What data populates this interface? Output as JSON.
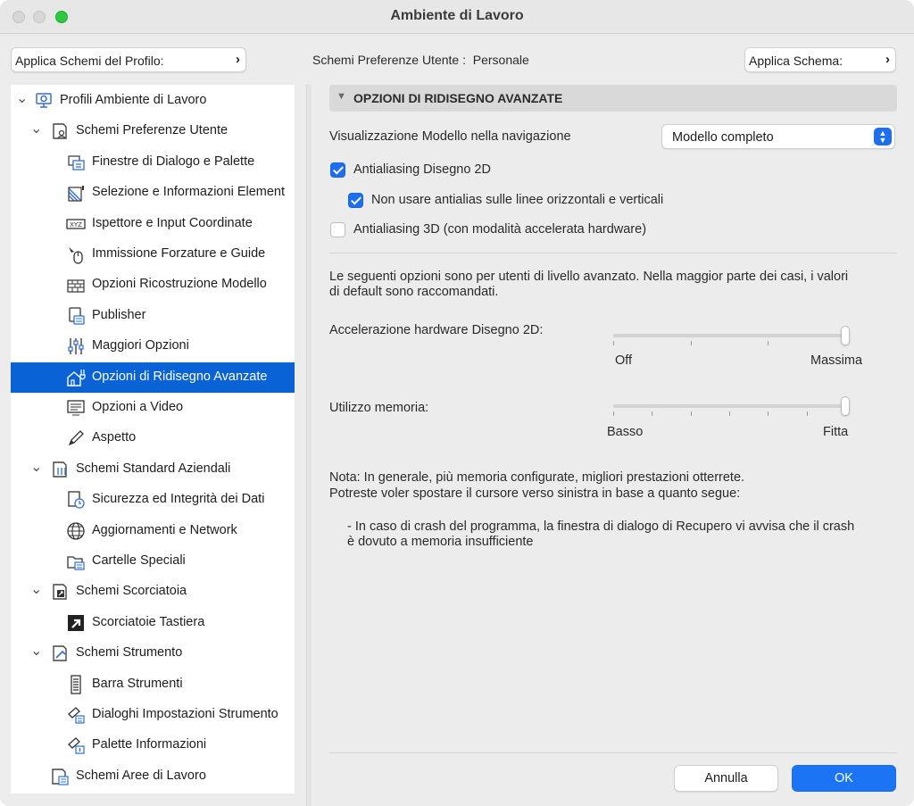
{
  "window": {
    "title": "Ambiente di Lavoro"
  },
  "top": {
    "apply_profile_label": "Applica Schemi del Profilo:",
    "user_schemes_label": "Schemi Preferenze Utente :",
    "user_schemes_value": "Personale",
    "apply_scheme_label": "Applica Schema:"
  },
  "sidebar": {
    "items": [
      {
        "label": "Profili Ambiente di Lavoro",
        "icon": "profile-monitor-icon",
        "level": 0,
        "expanded": true
      },
      {
        "label": "Schemi Preferenze Utente",
        "icon": "user-scheme-icon",
        "level": 1,
        "expanded": true
      },
      {
        "label": "Finestre di Dialogo e Palette",
        "icon": "dialog-palette-icon",
        "level": 2
      },
      {
        "label": "Selezione e Informazioni Element",
        "icon": "selection-info-icon",
        "level": 2
      },
      {
        "label": "Ispettore e Input Coordinate",
        "icon": "xyz-icon",
        "level": 2
      },
      {
        "label": "Immissione Forzature e Guide",
        "icon": "mouse-cursor-icon",
        "level": 2
      },
      {
        "label": "Opzioni Ricostruzione Modello",
        "icon": "brick-wall-icon",
        "level": 2
      },
      {
        "label": "Publisher",
        "icon": "publisher-icon",
        "level": 2
      },
      {
        "label": "Maggiori Opzioni",
        "icon": "sliders-icon",
        "level": 2
      },
      {
        "label": "Opzioni di Ridisegno Avanzate",
        "icon": "house-plug-icon",
        "level": 2,
        "selected": true
      },
      {
        "label": "Opzioni a Video",
        "icon": "monitor-icon",
        "level": 2
      },
      {
        "label": "Aspetto",
        "icon": "pencil-icon",
        "level": 2
      },
      {
        "label": "Schemi Standard Aziendali",
        "icon": "company-scheme-icon",
        "level": 1,
        "expanded": true
      },
      {
        "label": "Sicurezza ed Integrità dei Dati",
        "icon": "data-clock-icon",
        "level": 2
      },
      {
        "label": "Aggiornamenti e Network",
        "icon": "globe-icon",
        "level": 2
      },
      {
        "label": "Cartelle Speciali",
        "icon": "folder-icon",
        "level": 2
      },
      {
        "label": "Schemi Scorciatoia",
        "icon": "shortcut-scheme-icon",
        "level": 1,
        "expanded": true
      },
      {
        "label": "Scorciatoie Tastiera",
        "icon": "shortcut-arrow-icon",
        "level": 2
      },
      {
        "label": "Schemi Strumento",
        "icon": "tool-scheme-icon",
        "level": 1,
        "expanded": true
      },
      {
        "label": "Barra Strumenti",
        "icon": "toolbar-icon",
        "level": 2
      },
      {
        "label": "Dialoghi Impostazioni Strumento",
        "icon": "tool-settings-icon",
        "level": 2
      },
      {
        "label": "Palette Informazioni",
        "icon": "info-palette-icon",
        "level": 2
      },
      {
        "label": "Schemi Aree di Lavoro",
        "icon": "workspace-scheme-icon",
        "level": 1
      }
    ]
  },
  "panel": {
    "section_title": "OPZIONI DI RIDISEGNO AVANZATE",
    "nav_model_label": "Visualizzazione Modello nella navigazione",
    "nav_model_value": "Modello completo",
    "options": [
      {
        "label": "Antialiasing Disegno 2D",
        "checked": true
      },
      {
        "label": "Non usare antialias sulle linee orizzontali e verticali",
        "checked": true
      },
      {
        "label": "Antialiasing 3D (con modalità accelerata hardware)",
        "checked": false
      }
    ],
    "info_line1": "Le seguenti opzioni sono per utenti di livello avanzato. Nella maggior parte dei casi, i valori",
    "info_line2": "di default sono raccomandati.",
    "hw_accel": {
      "label": "Accelerazione hardware Disegno 2D:",
      "min_label": "Off",
      "max_label": "Massima",
      "value": 1.0,
      "ticks": 4
    },
    "memory": {
      "label": "Utilizzo memoria:",
      "min_label": "Basso",
      "max_label": "Fitta",
      "value": 1.0,
      "ticks": 7
    },
    "note_line1": "Nota: In generale, più memoria configurate, migliori prestazioni otterrete.",
    "note_line2": "Potreste voler spostare il cursore verso sinistra in base a quanto segue:",
    "note_bullet1": "- In caso di crash del programma, la finestra di dialogo di Recupero vi avvisa che il crash",
    "note_bullet2": "è dovuto a memoria insufficiente"
  },
  "footer": {
    "cancel_label": "Annulla",
    "ok_label": "OK"
  },
  "colors": {
    "accent": "#0a63d6",
    "ok_button": "#1b74f4"
  }
}
